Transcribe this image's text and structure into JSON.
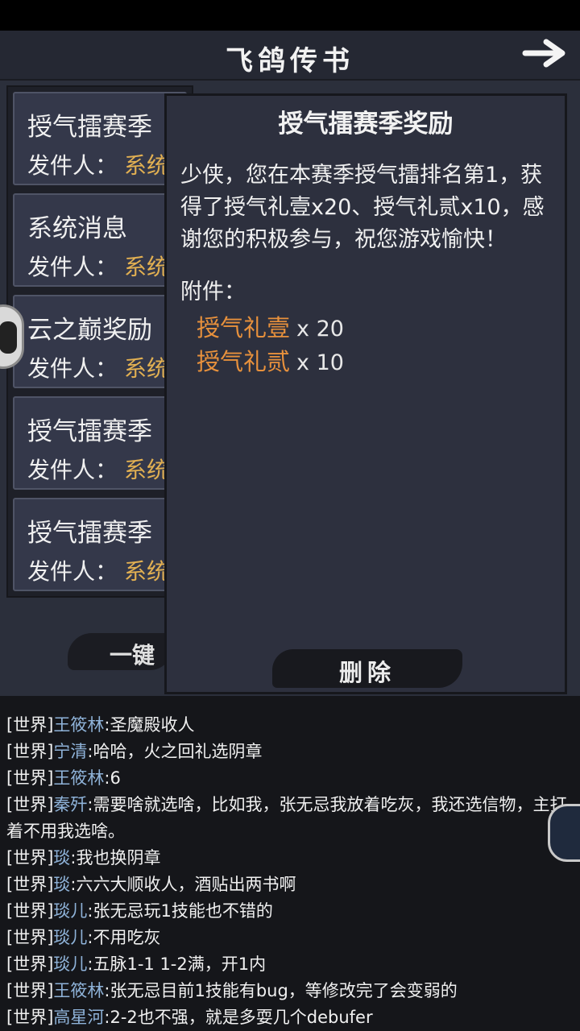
{
  "window": {
    "title": "飞鸽传书"
  },
  "mail_list": [
    {
      "subject": "授气擂赛季",
      "sender_label": "发件人：",
      "sender": "系统"
    },
    {
      "subject": "系统消息",
      "sender_label": "发件人：",
      "sender": "系统"
    },
    {
      "subject": "云之巅奖励",
      "sender_label": "发件人：",
      "sender": "系统"
    },
    {
      "subject": "授气擂赛季",
      "sender_label": "发件人：",
      "sender": "系统"
    },
    {
      "subject": "授气擂赛季",
      "sender_label": "发件人：",
      "sender": "系统"
    }
  ],
  "clear_all_label": "一键",
  "detail": {
    "title": "授气擂赛季奖励",
    "body": "少侠，您在本赛季授气擂排名第1，获得了授气礼壹x20、授气礼贰x10，感谢您的积极参与，祝您游戏愉快！",
    "attachments_label": "附件：",
    "attachments": [
      {
        "name": "授气礼壹",
        "qty": "x 20"
      },
      {
        "name": "授气礼贰",
        "qty": "x 10"
      }
    ],
    "delete_label": "删除"
  },
  "chat": [
    {
      "channel": "[世界]",
      "name": "王筱林",
      "message": ":圣魔殿收人"
    },
    {
      "channel": "[世界]",
      "name": "宁清",
      "message": ":哈哈，火之回礼选阴章"
    },
    {
      "channel": "[世界]",
      "name": "王筱林",
      "message": ":6"
    },
    {
      "channel": "[世界]",
      "name": "秦歼",
      "message": ":需要啥就选啥，比如我，张无忌我放着吃灰，我还选信物，主打着不用我选啥。"
    },
    {
      "channel": "[世界]",
      "name": "琰",
      "message": ":我也换阴章"
    },
    {
      "channel": "[世界]",
      "name": "琰",
      "message": ":六六大顺收人，酒贴出两书啊"
    },
    {
      "channel": "[世界]",
      "name": "琰儿",
      "message": ":张无忌玩1技能也不错的"
    },
    {
      "channel": "[世界]",
      "name": "琰儿",
      "message": ":不用吃灰"
    },
    {
      "channel": "[世界]",
      "name": "琰儿",
      "message": ":五脉1-1 1-2满，开1内"
    },
    {
      "channel": "[世界]",
      "name": "王筱林",
      "message": ":张无忌目前1技能有bug，等修改完了会变弱的"
    },
    {
      "channel": "[世界]",
      "name": "高星河",
      "message": ":2-2也不强，就是多耍几个debufer"
    }
  ],
  "colors": {
    "sender": "#e2b052",
    "attachment": "#e8913c",
    "chat_name": "#8fb3d9",
    "panel": "#2d303e"
  },
  "icons": [
    "back-arrow-icon"
  ]
}
